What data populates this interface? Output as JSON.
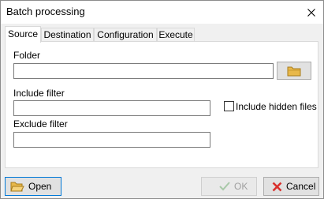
{
  "window": {
    "title": "Batch processing"
  },
  "tabs": [
    {
      "label": "Source",
      "active": true
    },
    {
      "label": "Destination",
      "active": false
    },
    {
      "label": "Configuration",
      "active": false
    },
    {
      "label": "Execute",
      "active": false
    }
  ],
  "source": {
    "folder_label": "Folder",
    "folder_value": "",
    "include_filter_label": "Include filter",
    "include_filter_value": "",
    "include_hidden_label": "Include hidden files",
    "include_hidden_checked": false,
    "exclude_filter_label": "Exclude filter",
    "exclude_filter_value": ""
  },
  "footer": {
    "open_label": "Open",
    "ok_label": "OK",
    "ok_enabled": false,
    "cancel_label": "Cancel"
  },
  "colors": {
    "folder_icon": "#e8b84a",
    "cancel_icon": "#d9302c",
    "ok_icon_disabled": "#a8c8a8"
  },
  "icons": {
    "browse": "folder-icon",
    "open": "open-folder-icon",
    "ok": "checkmark-icon",
    "cancel": "x-icon",
    "close": "close-icon"
  }
}
